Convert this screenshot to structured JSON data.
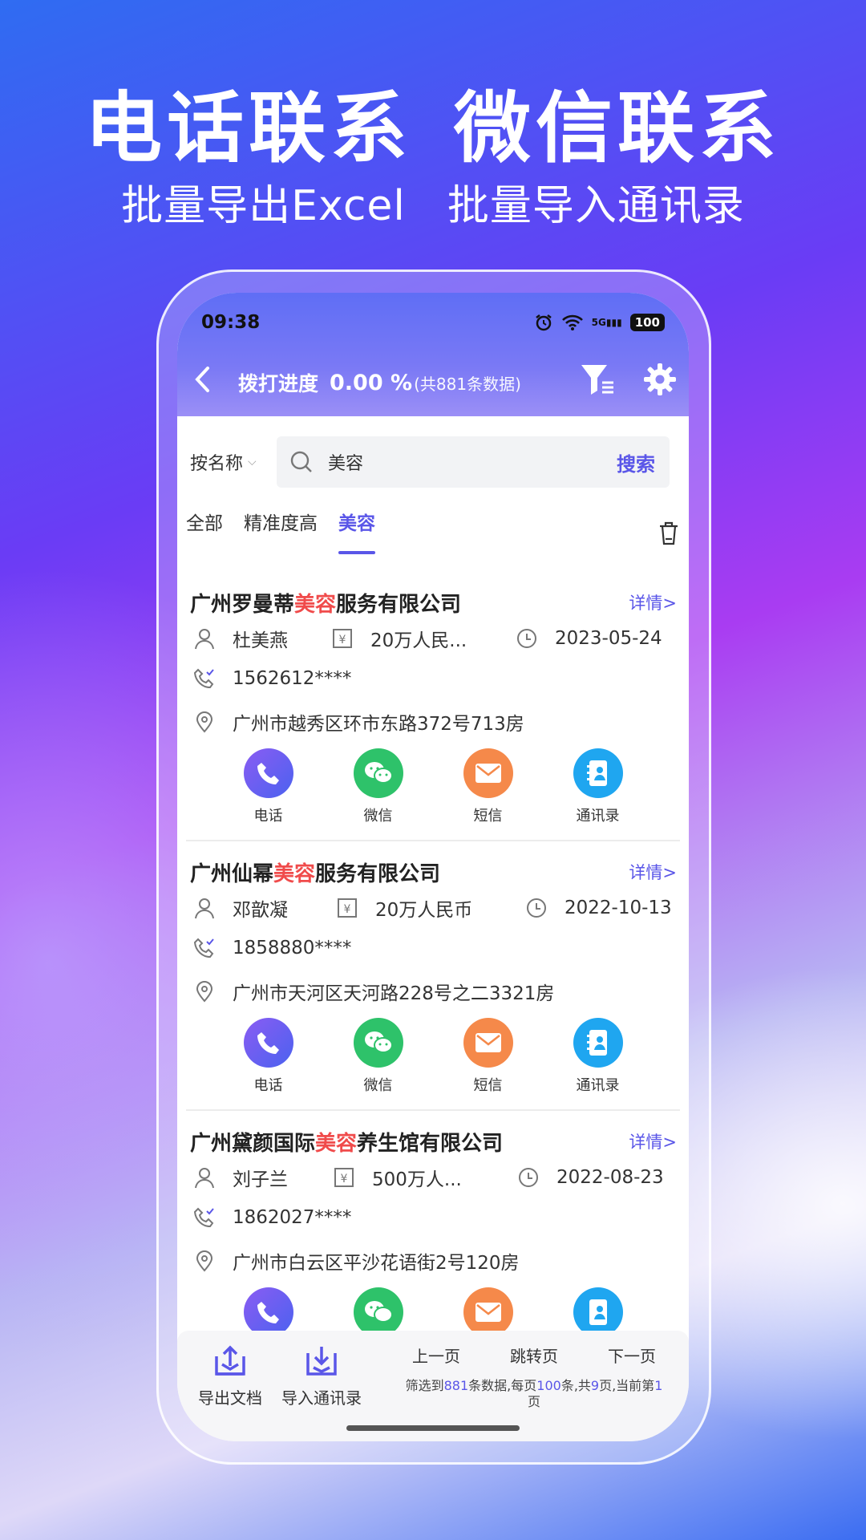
{
  "headline": {
    "line1_a": "电话联系",
    "line1_b": "微信联系",
    "line2_a": "批量导出Excel",
    "line2_b": "批量导入通讯录"
  },
  "status": {
    "time": "09:38",
    "battery": "100",
    "signal": "5G"
  },
  "nav": {
    "title": "拨打进度",
    "percent": "0.00 %",
    "count": "(共881条数据)"
  },
  "search": {
    "select_label": "按名称",
    "value": "美容",
    "button": "搜索"
  },
  "tabs": [
    {
      "label": "全部"
    },
    {
      "label": "精准度高"
    },
    {
      "label": "美容"
    }
  ],
  "cards": [
    {
      "title_pre": "广州罗曼蒂",
      "title_hl": "美容",
      "title_post": "服务有限公司",
      "detail": "详情>",
      "person": "杜美燕",
      "capital": "20万人民...",
      "date": "2023-05-24",
      "phone": "1562612****",
      "address": "广州市越秀区环市东路372号713房"
    },
    {
      "title_pre": "广州仙幂",
      "title_hl": "美容",
      "title_post": "服务有限公司",
      "detail": "详情>",
      "person": "邓歆凝",
      "capital": "20万人民币",
      "date": "2022-10-13",
      "phone": "1858880****",
      "address": "广州市天河区天河路228号之二3321房"
    },
    {
      "title_pre": "广州黛颜国际",
      "title_hl": "美容",
      "title_post": "养生馆有限公司",
      "detail": "详情>",
      "person": "刘子兰",
      "capital": "500万人...",
      "date": "2022-08-23",
      "phone": "1862027****",
      "address": "广州市白云区平沙花语街2号120房"
    }
  ],
  "actions": {
    "call": "电话",
    "wechat": "微信",
    "sms": "短信",
    "contacts": "通讯录"
  },
  "colors": {
    "call": "#6b5cf2",
    "wechat": "#2ec26a",
    "sms": "#f5894a",
    "contacts": "#1fa6f0",
    "accent": "#5a56e8",
    "highlight": "#f04b4b"
  },
  "bottom": {
    "export": "导出文档",
    "import": "导入通讯录",
    "prev": "上一页",
    "jump": "跳转页",
    "next": "下一页",
    "info_a": "筛选到",
    "total": "881",
    "info_b": "条数据,每页",
    "per_page": "100",
    "info_c": "条,共",
    "pages": "9",
    "info_d": "页,当前第",
    "current": "1",
    "info_e": "页"
  }
}
